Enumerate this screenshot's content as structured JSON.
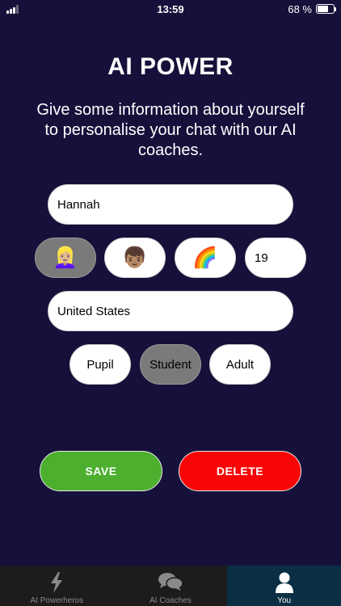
{
  "status_bar": {
    "time": "13:59",
    "battery_text": "68 %"
  },
  "header": {
    "title": "AI POWER",
    "subtitle": "Give some information about yourself to personalise your chat with our AI coaches."
  },
  "form": {
    "name_value": "Hannah",
    "avatars": [
      {
        "emoji": "👱🏼‍♀️",
        "selected": true
      },
      {
        "emoji": "👦🏽",
        "selected": false
      },
      {
        "emoji": "🌈",
        "selected": false
      }
    ],
    "age_value": "19",
    "country_value": "United States",
    "roles": [
      {
        "label": "Pupil",
        "selected": false
      },
      {
        "label": "Student",
        "selected": true
      },
      {
        "label": "Adult",
        "selected": false
      }
    ]
  },
  "actions": {
    "save_label": "SAVE",
    "delete_label": "DELETE"
  },
  "tabbar": {
    "tabs": [
      {
        "label": "AI Powerheros",
        "icon": "lightning-icon",
        "active": false
      },
      {
        "label": "AI Coaches",
        "icon": "chat-bubbles-icon",
        "active": false
      },
      {
        "label": "You",
        "icon": "person-icon",
        "active": true
      }
    ]
  },
  "colors": {
    "background": "#15113a",
    "save": "#4caf2e",
    "delete": "#f80607",
    "selected_pill": "#7a7a7a",
    "active_tab": "#0a2f45"
  }
}
